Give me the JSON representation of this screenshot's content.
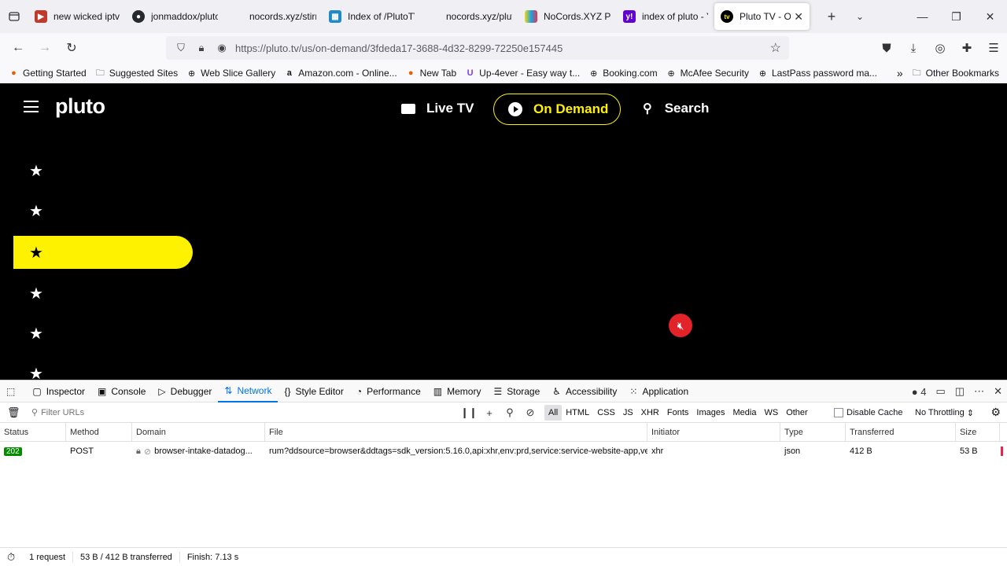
{
  "tabs": [
    {
      "title": "new wicked iptv",
      "favicon_color": "#c0392b",
      "favicon": "iptv-icon"
    },
    {
      "title": "jonmaddox/pluto",
      "favicon_color": "#24292f",
      "favicon": "github-icon"
    },
    {
      "title": "nocords.xyz/stirr/pla",
      "favicon_color": "",
      "favicon": "blank-page-icon"
    },
    {
      "title": "Index of /PlutoTV",
      "favicon_color": "#1f8ac8",
      "favicon": "folder-index-icon"
    },
    {
      "title": "nocords.xyz/pluto/pl",
      "favicon_color": "",
      "favicon": "blank-page-icon"
    },
    {
      "title": "NoCords.XYZ Plu",
      "favicon_color": "#6b3fa0",
      "favicon": "tv-color-icon"
    },
    {
      "title": "index of pluto - Y",
      "favicon_color": "#6001d2",
      "favicon": "yahoo-icon"
    },
    {
      "title": "Pluto TV - On",
      "favicon_color": "#000000",
      "favicon": "pluto-tv-icon",
      "active": true
    }
  ],
  "url": "https://pluto.tv/us/on-demand/3fdeda17-3688-4d32-8299-72250e157445",
  "bookmarks": [
    {
      "label": "Getting Started",
      "icon": "firefox-icon"
    },
    {
      "label": "Suggested Sites",
      "icon": "folder-icon"
    },
    {
      "label": "Web Slice Gallery",
      "icon": "globe-icon"
    },
    {
      "label": "Amazon.com - Online...",
      "icon": "amazon-icon"
    },
    {
      "label": "New Tab",
      "icon": "firefox-icon"
    },
    {
      "label": "Up-4ever - Easy way t...",
      "icon": "up4ever-icon"
    },
    {
      "label": "Booking.com",
      "icon": "globe-icon"
    },
    {
      "label": "McAfee Security",
      "icon": "globe-icon"
    },
    {
      "label": "LastPass password ma...",
      "icon": "globe-icon"
    }
  ],
  "bookmarks_other": "Other Bookmarks",
  "pluto": {
    "logo": "pluto",
    "nav": {
      "live": "Live TV",
      "on_demand": "On Demand",
      "search": "Search"
    },
    "accent": "#fff200",
    "sidebar_icon": "star-icon"
  },
  "devtools": {
    "tabs": [
      "Inspector",
      "Console",
      "Debugger",
      "Network",
      "Style Editor",
      "Performance",
      "Memory",
      "Storage",
      "Accessibility",
      "Application"
    ],
    "active_tab": "Network",
    "error_count": "4",
    "filter_placeholder": "Filter URLs",
    "type_filters": [
      "All",
      "HTML",
      "CSS",
      "JS",
      "XHR",
      "Fonts",
      "Images",
      "Media",
      "WS",
      "Other"
    ],
    "disable_cache": "Disable Cache",
    "throttling": "No Throttling",
    "columns": [
      "Status",
      "Method",
      "Domain",
      "File",
      "Initiator",
      "Type",
      "Transferred",
      "Size"
    ],
    "rows": [
      {
        "status": "202",
        "method": "POST",
        "domain": "browser-intake-datadog...",
        "file": "rum?ddsource=browser&ddtags=sdk_version:5.16.0,api:xhr,env:prd,service:service-website-app,vers",
        "initiator": "xhr",
        "type": "json",
        "transferred": "412 B",
        "size": "53 B"
      }
    ],
    "summary": {
      "requests": "1 request",
      "transferred": "53 B / 412 B transferred",
      "finish": "Finish: 7.13 s"
    }
  }
}
